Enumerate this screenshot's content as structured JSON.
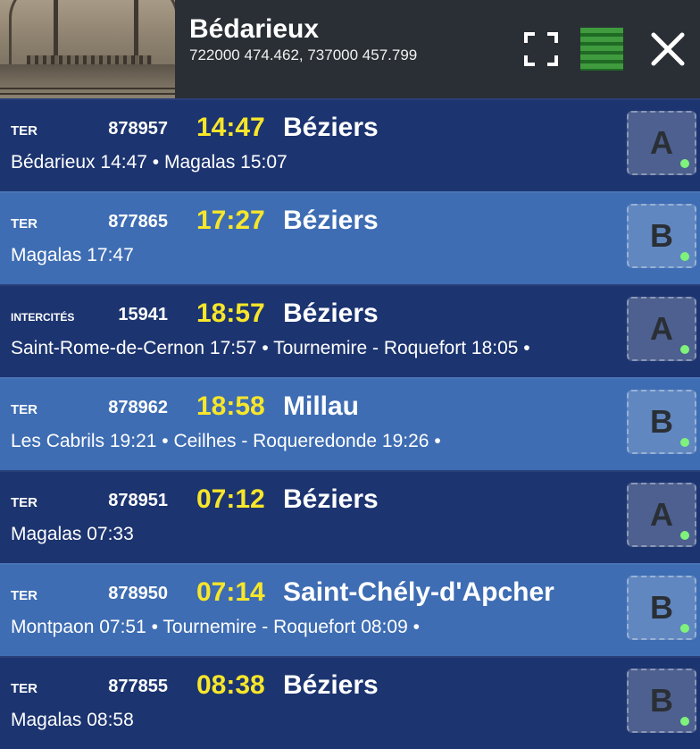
{
  "header": {
    "station": "Bédarieux",
    "coords": "722000 474.462, 737000 457.799",
    "fullscreen_icon": "fullscreen-icon",
    "map_icon": "green-bars-icon",
    "close_icon": "close-icon",
    "accent": "#f7e62a"
  },
  "departures": [
    {
      "type": "TER",
      "number": "878957",
      "time": "14:47",
      "destination": "Béziers",
      "stops": "Bédarieux 14:47 • Magalas 15:07",
      "platform": "A"
    },
    {
      "type": "TER",
      "number": "877865",
      "time": "17:27",
      "destination": "Béziers",
      "stops": "Magalas 17:47",
      "platform": "B"
    },
    {
      "type": "INTERCITÉS",
      "number": "15941",
      "time": "18:57",
      "destination": "Béziers",
      "stops": "Saint-Rome-de-Cernon 17:57 • Tournemire - Roquefort 18:05 •",
      "platform": "A"
    },
    {
      "type": "TER",
      "number": "878962",
      "time": "18:58",
      "destination": "Millau",
      "stops": "Les Cabrils 19:21 • Ceilhes - Roqueredonde 19:26 •",
      "platform": "B"
    },
    {
      "type": "TER",
      "number": "878951",
      "time": "07:12",
      "destination": "Béziers",
      "stops": "Magalas 07:33",
      "platform": "A"
    },
    {
      "type": "TER",
      "number": "878950",
      "time": "07:14",
      "destination": "Saint-Chély-d'Apcher",
      "stops": "Montpaon 07:51 • Tournemire - Roquefort 08:09 •",
      "platform": "B"
    },
    {
      "type": "TER",
      "number": "877855",
      "time": "08:38",
      "destination": "Béziers",
      "stops": "Magalas 08:58",
      "platform": "B"
    }
  ]
}
